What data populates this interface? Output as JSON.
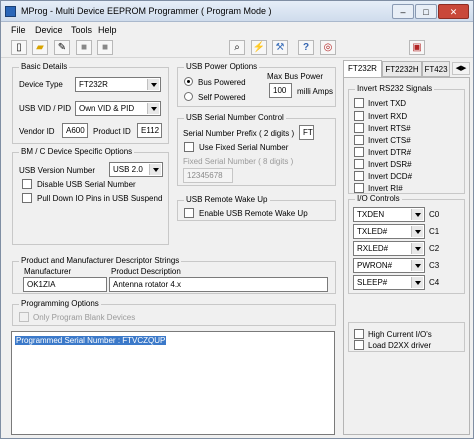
{
  "window": {
    "title": "MProg - Multi Device EEPROM Programmer ( Program Mode )"
  },
  "menu": [
    "File",
    "Device",
    "Tools",
    "Help"
  ],
  "toolbar": [
    "new-icon",
    "open-icon",
    "edit-icon",
    "stop-icon",
    "stop-icon",
    "search-icon",
    "wand-icon",
    "tool-icon",
    "help-icon",
    "about-icon",
    "window-icon"
  ],
  "basic_details": {
    "title": "Basic Details",
    "device_type_label": "Device Type",
    "device_type_value": "FT232R",
    "usb_vid_pid_label": "USB VID / PID",
    "usb_vid_pid_value": "Own VID & PID",
    "vendor_id_label": "Vendor ID",
    "vendor_id_value": "A600",
    "product_id_label": "Product ID",
    "product_id_value": "E112"
  },
  "usb_power": {
    "title": "USB Power Options",
    "bus_powered": "Bus Powered",
    "self_powered": "Self Powered",
    "max_bus_power_label": "Max Bus Power",
    "max_bus_power_value": "100",
    "milli_amps_label": "milli Amps"
  },
  "serial_number": {
    "title": "USB Serial Number Control",
    "prefix_label": "Serial Number Prefix ( 2 digits )",
    "prefix_value": "FT",
    "use_fixed_label": "Use Fixed Serial Number",
    "fixed_label": "Fixed Serial Number ( 8 digits )",
    "fixed_value": "12345678"
  },
  "bm_options": {
    "title": "BM / C Device Specific Options",
    "usb_version_label": "USB Version Number",
    "usb_version_value": "USB 2.0",
    "disable_usb_serial_label": "Disable USB Serial Number",
    "pull_down_label": "Pull Down IO Pins in USB Suspend"
  },
  "remote_wakeup": {
    "title": "USB Remote Wake Up",
    "enable_label": "Enable USB Remote Wake Up"
  },
  "descriptor": {
    "title": "Product and Manufacturer Descriptor Strings",
    "manufacturer_label": "Manufacturer",
    "manufacturer_value": "OK1ZIA",
    "product_label": "Product Description",
    "product_value": "Antenna rotator 4.x"
  },
  "programming_options": {
    "title": "Programming Options",
    "only_program_blank": "Only Program Blank Devices"
  },
  "status": {
    "message": "Programmed Serial Number : FTVCZQUP"
  },
  "tabs": [
    "FT232R",
    "FT2232H",
    "FT423"
  ],
  "invert_signals": {
    "title": "Invert RS232 Signals",
    "items": [
      "Invert TXD",
      "Invert RXD",
      "Invert RTS#",
      "Invert CTS#",
      "Invert DTR#",
      "Invert DSR#",
      "Invert DCD#",
      "Invert RI#"
    ]
  },
  "io_controls": {
    "title": "I/O Controls",
    "items": [
      {
        "value": "TXDEN",
        "label": "C0"
      },
      {
        "value": "TXLED#",
        "label": "C1"
      },
      {
        "value": "RXLED#",
        "label": "C2"
      },
      {
        "value": "PWRON#",
        "label": "C3"
      },
      {
        "value": "SLEEP#",
        "label": "C4"
      }
    ]
  },
  "high_current": {
    "high_current_label": "High Current I/O's",
    "load_d2xx_label": "Load D2XX driver"
  }
}
